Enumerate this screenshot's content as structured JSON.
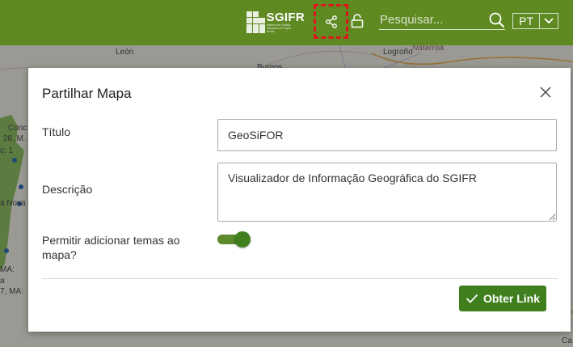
{
  "header": {
    "logo_text": "SGIFR",
    "logo_subtext": "Sistema de Gestão Integrada de Fogos Rurais",
    "search_placeholder": "Pesquisar...",
    "language": "PT",
    "colors": {
      "bar": "#5f8a22",
      "highlight": "#e0141c"
    },
    "icons": [
      "share-icon",
      "lock-icon",
      "search-icon",
      "chevron-down-icon"
    ]
  },
  "map": {
    "labels": [
      "León",
      "Burgos",
      "Logroño",
      "Nafarroa",
      "Conc",
      "28, M",
      "c: 1",
      "a Nova",
      "MA:",
      "a",
      "7, MA:",
      "Ca"
    ]
  },
  "dialog": {
    "title": "Partilhar Mapa",
    "fields": {
      "title_label": "Título",
      "title_value": "GeoSiFOR",
      "description_label": "Descrição",
      "description_value": "Visualizador de Informação Geográfica do SGIFR",
      "allow_layers_label": "Permitir adicionar temas ao mapa?",
      "allow_layers_enabled": true
    },
    "submit_label": "Obter Link",
    "accent_color": "#3f7f1e"
  }
}
